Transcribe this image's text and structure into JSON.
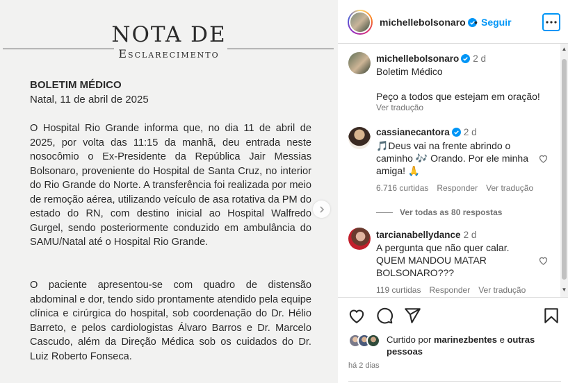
{
  "post_image": {
    "title": "NOTA DE",
    "subtitle": "Esclarecimento",
    "heading": "BOLETIM MÉDICO",
    "date": "Natal, 11 de abril de 2025",
    "paragraph1": "O Hospital Rio Grande informa que, no dia 11 de abril de 2025, por volta das 11:15 da manhã, deu entrada neste nosocômio o Ex-Presidente da República Jair Messias Bolsonaro, proveniente do Hospital de Santa Cruz, no interior do Rio Grande do Norte. A transferência foi realizada por meio de remoção aérea, utilizando veículo de asa rotativa da PM do estado do RN, com destino inicial ao Hospital Walfredo Gurgel, sendo posteriormente conduzido em ambulância do SAMU/Natal até o Hospital Rio Grande.",
    "paragraph2": "O paciente apresentou-se com quadro de distensão abdominal e dor, tendo sido prontamente atendido pela equipe clínica e cirúrgica do hospital, sob coordenação do Dr. Hélio Barreto, e pelos cardiologistas Álvaro Barros e Dr. Marcelo Cascudo, além da Direção Médica sob os cuidados do Dr. Luiz Roberto Fonseca."
  },
  "header": {
    "username": "michellebolsonaro",
    "separator": "•",
    "follow_label": "Seguir"
  },
  "caption": {
    "username": "michellebolsonaro",
    "time": "2 d",
    "line1": "Boletim Médico",
    "line2": "Peço a todos que estejam em oração!",
    "translate": "Ver tradução"
  },
  "comments": [
    {
      "username": "cassianecantora",
      "time": "2 d",
      "text": "🎵Deus vai na frente abrindo o caminho 🎶 Orando. Por ele minha amiga! 🙏",
      "likes": "6.716 curtidas",
      "reply": "Responder",
      "translate": "Ver tradução"
    },
    {
      "username": "tarcianabellydance",
      "time": "2 d",
      "text": "A pergunta que não quer calar. QUEM MANDOU MATAR BOLSONARO???",
      "likes": "119 curtidas",
      "reply": "Responder",
      "translate": "Ver tradução"
    }
  ],
  "view_replies": "Ver todas as 80 respostas",
  "likes": {
    "prefix": "Curtido por",
    "user": "marinezbentes",
    "connector": "e",
    "others": "outras pessoas"
  },
  "post_age": "há 2 dias",
  "colors": {
    "link_blue": "#0095f6",
    "verified_blue": "#0095f6",
    "muted": "#737373"
  }
}
